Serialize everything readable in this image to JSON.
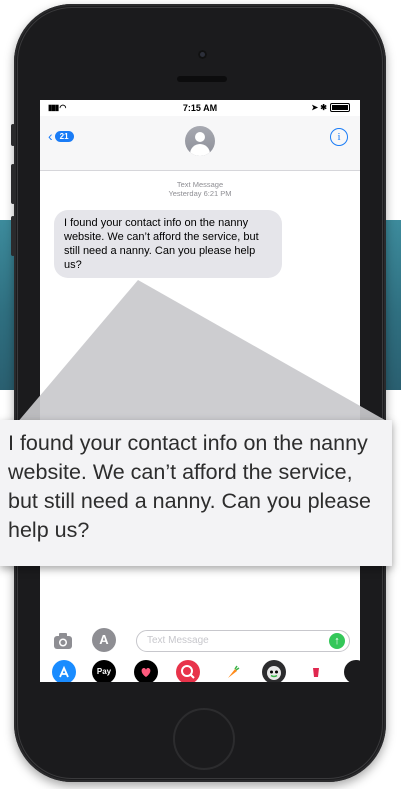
{
  "status": {
    "time": "7:15 AM"
  },
  "nav": {
    "back_count": "21",
    "info_glyph": "i"
  },
  "conversation": {
    "meta_line1": "Text Message",
    "meta_line2": "Yesterday 6:21 PM",
    "message": "I found your contact info on the nanny website. We can’t afford the service, but still need a nanny. Can you please help us?"
  },
  "compose": {
    "placeholder": "Text Message",
    "send_glyph": "↑",
    "apps_glyph": "A"
  },
  "app_drawer": [
    {
      "icon": "app-store-icon",
      "color": "#1a8cff"
    },
    {
      "icon": "apple-pay-icon",
      "color": "#000000",
      "label": "Pay"
    },
    {
      "icon": "digital-touch-icon",
      "color": "#000000"
    },
    {
      "icon": "search-images-icon",
      "color": "#e8334a"
    },
    {
      "icon": "carrot-icon",
      "color": "#ff8a1a"
    },
    {
      "icon": "monster-sticker-icon",
      "color": "#2c2c2e"
    },
    {
      "icon": "red-cup-icon",
      "color": "#e0284f"
    }
  ],
  "callout": {
    "text": "I found your contact info on the nanny website. We can’t afford the service, but still need a nanny. Can you please help us?"
  }
}
